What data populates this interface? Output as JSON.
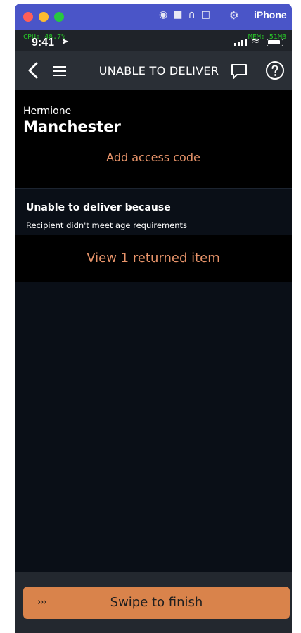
{
  "simulator": {
    "device_label": "iPhone",
    "toolbar_icons": [
      "camera-icon",
      "video-icon",
      "headphones-icon",
      "rotate-icon",
      "gear-icon"
    ]
  },
  "status_bar": {
    "time": "9:41",
    "cpu": "CPU: 48.7%",
    "mem": "MEM: 51MB"
  },
  "nav": {
    "title": "UNABLE TO DELIVER",
    "icons": [
      "back-chevron-icon",
      "hamburger-menu-icon",
      "chat-bubble-icon",
      "help-circle-icon"
    ]
  },
  "address": {
    "name": "Hermione",
    "city": "Manchester",
    "access_code_link": "Add access code"
  },
  "reason": {
    "title": "Unable to deliver because",
    "detail": "Recipient didn't meet age requirements"
  },
  "returned": {
    "link": "View 1 returned item"
  },
  "swipe": {
    "chevrons": "›››",
    "label": "Swipe to finish"
  },
  "colors": {
    "accent": "#e8946a",
    "swipe_button": "#d9834b",
    "nav_bar": "#2a2f36",
    "background": "#0a0f17"
  }
}
